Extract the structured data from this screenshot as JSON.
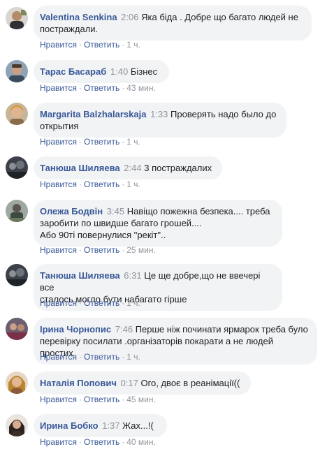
{
  "actions": {
    "like_label": "Нравится",
    "reply_label": "Ответить",
    "separator": "·"
  },
  "comments": [
    {
      "author": "Valentina Senkina",
      "time": "2:06",
      "lines": [
        "Яка біда . Добре що багато людей не",
        "постраждали."
      ],
      "ago": "1 ч."
    },
    {
      "author": "Тарас Басараб",
      "time": "1:40",
      "lines": [
        "Бізнес"
      ],
      "ago": "43 мин."
    },
    {
      "author": "Margarita Balzhalarskaja",
      "time": "1:33",
      "lines": [
        "Проверять надо было до",
        "открытия"
      ],
      "ago": "1 ч."
    },
    {
      "author": "Танюша Шиляева",
      "time": "2:44",
      "lines": [
        "3 постраждалих"
      ],
      "ago": "1 ч."
    },
    {
      "author": "Олежа Бодвін",
      "time": "3:45",
      "lines": [
        "Навіщо пожежна безпека.... треба",
        "заробити по швидше багато грошей....",
        "Або 90ті повернулися \"рекіт\".."
      ],
      "ago": "25 мин."
    },
    {
      "author": "Танюша Шиляева",
      "time": "6:31",
      "lines": [
        "Це ще добре,що не ввечері все",
        "сталось могло бути набагато гірше"
      ],
      "ago": "1 ч."
    },
    {
      "author": "Ірина Чорнопис",
      "time": "7:46",
      "lines": [
        "Перше ніж починати ярмарок треба було",
        "перевірку посилати .організаторів покарати а не людей простих"
      ],
      "ago": "1 ч."
    },
    {
      "author": "Наталія Попович",
      "time": "0:17",
      "lines": [
        "Ого, двоє в реанімації(("
      ],
      "ago": "45 мин."
    },
    {
      "author": "Ирина Бобко",
      "time": "1:37",
      "lines": [
        "Жах...!("
      ],
      "ago": "40 мин."
    }
  ]
}
